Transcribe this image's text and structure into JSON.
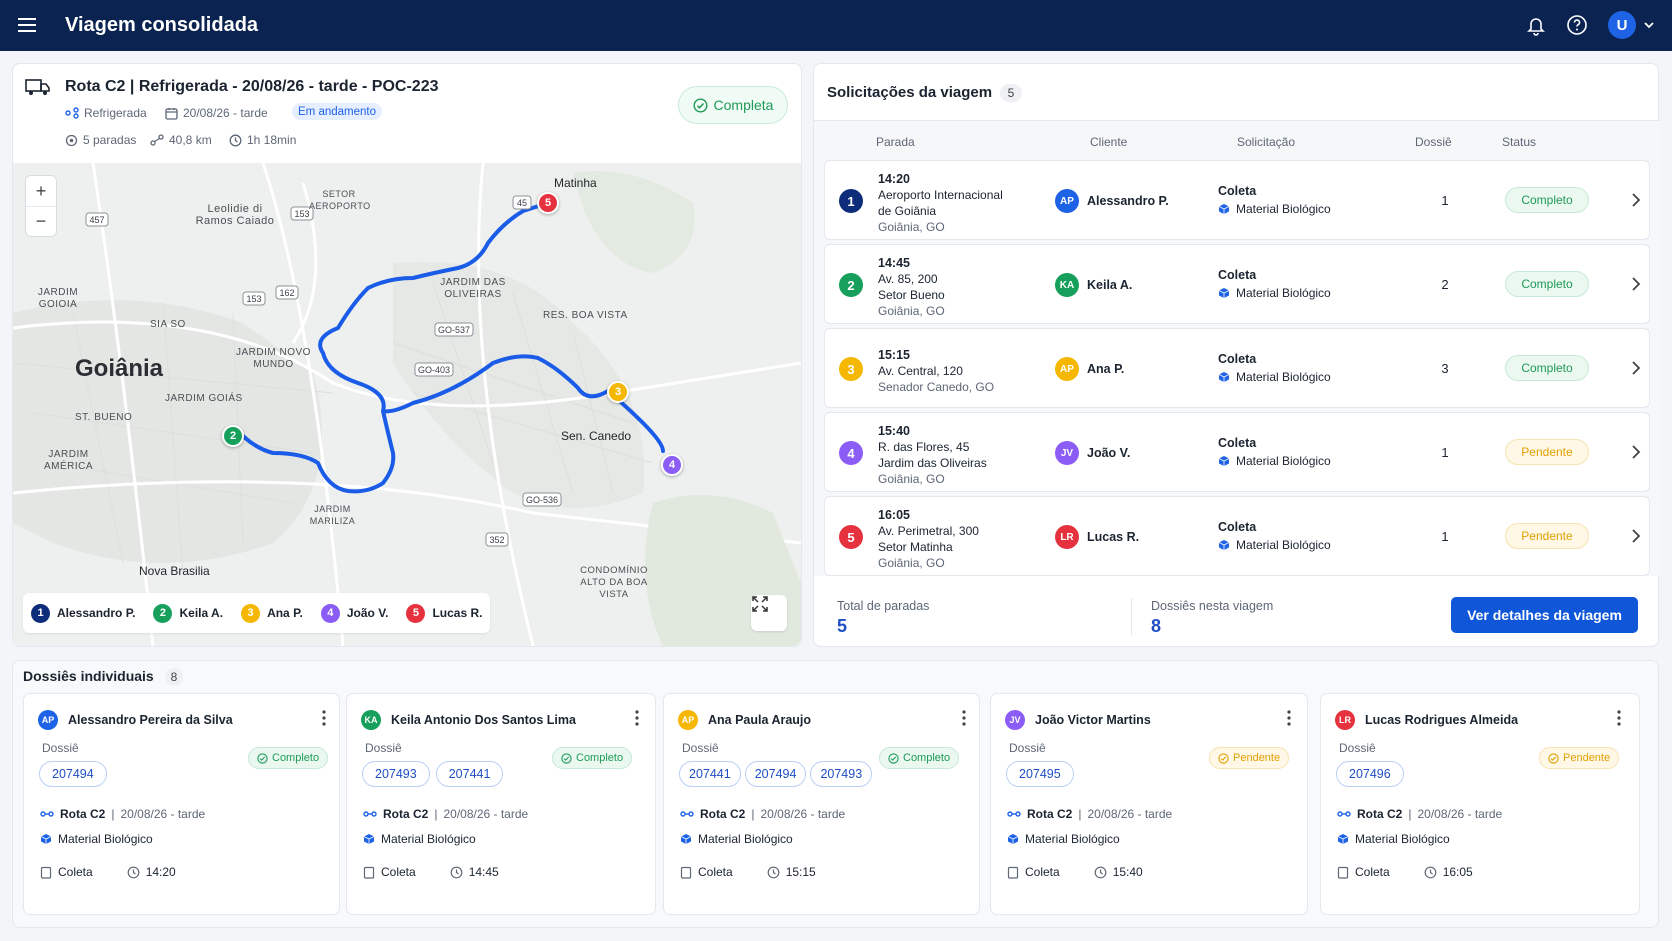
{
  "app": {
    "title": "Viagem consolidada",
    "user_initial": "U"
  },
  "trip": {
    "title": "Rota C2 | Refrigerada - 20/08/26 - tarde - POC-223",
    "type": "Refrigerada",
    "date": "20/08/26 - tarde",
    "state": "Em andamento",
    "stops": "5 paradas",
    "distance": "40,8 km",
    "duration": "1h 18min",
    "status": "Completa"
  },
  "map": {
    "city": "Goiânia",
    "places": [
      "Matinha",
      "Leolidie di Ramos Caiado",
      "SETOR AEROPORTO",
      "JARDIM GOIOIA",
      "JARDIM DAS OLIVEIRAS",
      "RES. BOA VISTA",
      "SIA SO",
      "JARDIM NOVO MUNDO",
      "JARDIM GOIÁS",
      "ST. BUENO",
      "JARDIM AMÉRICA",
      "Sen. Canedo",
      "JARDIM MARILIZA",
      "Nova Brasilia",
      "CONDOMÍNIO ALTO DA BOA VISTA"
    ],
    "roads": [
      "457",
      "153",
      "153",
      "162",
      "GO-537",
      "GO-403",
      "GO-536",
      "352",
      "45"
    ],
    "zoom_in": "+",
    "zoom_out": "−",
    "legend": [
      {
        "n": "1",
        "name": "Alessandro P."
      },
      {
        "n": "2",
        "name": "Keila A."
      },
      {
        "n": "3",
        "name": "Ana P."
      },
      {
        "n": "4",
        "name": "João V."
      },
      {
        "n": "5",
        "name": "Lucas R."
      }
    ]
  },
  "requests": {
    "title": "Solicitações da viagem",
    "count": "5",
    "headers": [
      "Parada",
      "Cliente",
      "Solicitação",
      "Dossiê",
      "Status"
    ],
    "rows": [
      {
        "n": "1",
        "time": "14:20",
        "addr1": "Aeroporto Internacional",
        "addr2": "de Goiânia",
        "city": "Goiânia, GO",
        "initials": "AP",
        "client": "Alessandro P.",
        "type": "Coleta",
        "material": "Material Biológico",
        "dossie": "1",
        "status": "Completo"
      },
      {
        "n": "2",
        "time": "14:45",
        "addr1": "Av. 85, 200",
        "addr2": "Setor Bueno",
        "city": "Goiânia, GO",
        "initials": "KA",
        "client": "Keila A.",
        "type": "Coleta",
        "material": "Material Biológico",
        "dossie": "2",
        "status": "Completo"
      },
      {
        "n": "3",
        "time": "15:15",
        "addr1": "Av. Central, 120",
        "addr2": "",
        "city": "Senador Canedo, GO",
        "initials": "AP",
        "client": "Ana P.",
        "type": "Coleta",
        "material": "Material Biológico",
        "dossie": "3",
        "status": "Completo"
      },
      {
        "n": "4",
        "time": "15:40",
        "addr1": "R. das Flores, 45",
        "addr2": "Jardim das Oliveiras",
        "city": "Goiânia, GO",
        "initials": "JV",
        "client": "João V.",
        "type": "Coleta",
        "material": "Material Biológico",
        "dossie": "1",
        "status": "Pendente"
      },
      {
        "n": "5",
        "time": "16:05",
        "addr1": "Av. Perimetral, 300",
        "addr2": "Setor Matinha",
        "city": "Goiânia, GO",
        "initials": "LR",
        "client": "Lucas R.",
        "type": "Coleta",
        "material": "Material Biológico",
        "dossie": "1",
        "status": "Pendente"
      }
    ],
    "total_stops_label": "Total de paradas",
    "total_stops": "5",
    "dossiers_label": "Dossiês nesta viagem",
    "dossiers": "8",
    "details_button": "Ver detalhes da viagem"
  },
  "dossiers": {
    "title": "Dossiês individuais",
    "count": "8",
    "label": "Dossiê",
    "cards": [
      {
        "initials": "AP",
        "name": "Alessandro Pereira da Silva",
        "chips": [
          "207494"
        ],
        "status": "Completo",
        "route": "Rota C2",
        "date": "20/08/26 - tarde",
        "material": "Material Biológico",
        "type": "Coleta",
        "time": "14:20"
      },
      {
        "initials": "KA",
        "name": "Keila Antonio Dos Santos Lima",
        "chips": [
          "207493",
          "207441"
        ],
        "status": "Completo",
        "route": "Rota C2",
        "date": "20/08/26 - tarde",
        "material": "Material Biológico",
        "type": "Coleta",
        "time": "14:45"
      },
      {
        "initials": "AP",
        "name": "Ana Paula Araujo",
        "chips": [
          "207441",
          "207494",
          "207493"
        ],
        "status": "Completo",
        "route": "Rota C2",
        "date": "20/08/26 - tarde",
        "material": "Material Biológico",
        "type": "Coleta",
        "time": "15:15"
      },
      {
        "initials": "JV",
        "name": "João Victor Martins",
        "chips": [
          "207495"
        ],
        "status": "Pendente",
        "route": "Rota C2",
        "date": "20/08/26 - tarde",
        "material": "Material Biológico",
        "type": "Coleta",
        "time": "15:40"
      },
      {
        "initials": "LR",
        "name": "Lucas Rodrigues Almeida",
        "chips": [
          "207496"
        ],
        "status": "Pendente",
        "route": "Rota C2",
        "date": "20/08/26 - tarde",
        "material": "Material Biológico",
        "type": "Coleta",
        "time": "16:05"
      }
    ]
  },
  "colors": {
    "n1": "#0d2c7a",
    "n2": "#16a05b",
    "n3": "#f5b700",
    "n4": "#8b5cf6",
    "n5": "#e5323e",
    "route": "#1a5ce8",
    "primary": "#0f56d9"
  }
}
